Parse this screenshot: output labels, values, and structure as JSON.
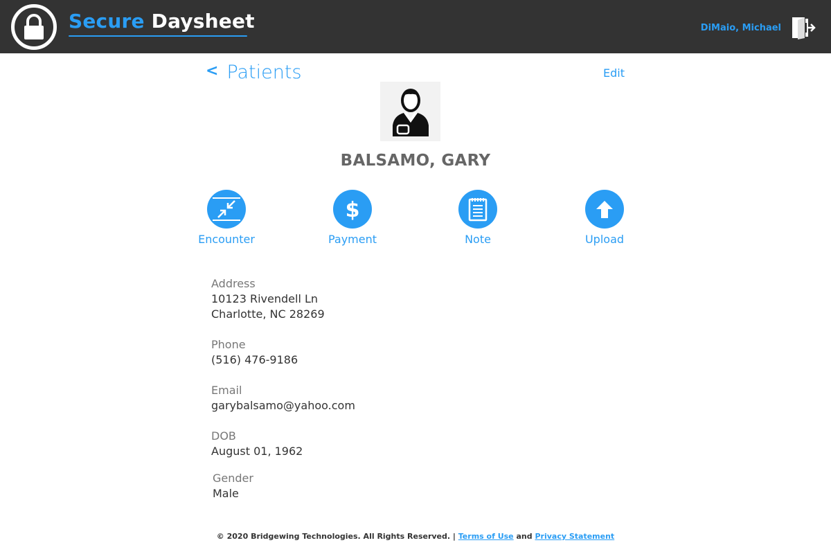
{
  "header": {
    "brand_part1": "Secure",
    "brand_part2": "Daysheet",
    "user_name": "DiMaio, Michael",
    "accent_color": "#2a9df4",
    "bar_color": "#333333"
  },
  "nav": {
    "back_chevron": "<",
    "back_label": "Patients",
    "edit_label": "Edit"
  },
  "patient": {
    "name": "BALSAMO, GARY",
    "avatar_icon": "person-icon"
  },
  "actions": [
    {
      "label": "Encounter",
      "icon": "arrows-in-icon"
    },
    {
      "label": "Payment",
      "icon": "dollar-icon"
    },
    {
      "label": "Note",
      "icon": "note-icon"
    },
    {
      "label": "Upload",
      "icon": "upload-arrow-icon"
    }
  ],
  "details": {
    "address": {
      "label": "Address",
      "line1": "10123 Rivendell Ln",
      "line2": "Charlotte, NC 28269"
    },
    "phone": {
      "label": "Phone",
      "value": "(516) 476-9186"
    },
    "email": {
      "label": "Email",
      "value": "garybalsamo@yahoo.com"
    },
    "dob": {
      "label": "DOB",
      "value": "August 01, 1962"
    },
    "gender": {
      "label": "Gender",
      "value": "Male"
    }
  },
  "footer": {
    "copyright": "© 2020 Bridgewing Technologies. All Rights Reserved. |",
    "terms": "Terms of Use",
    "and": "and",
    "privacy": "Privacy Statement"
  }
}
